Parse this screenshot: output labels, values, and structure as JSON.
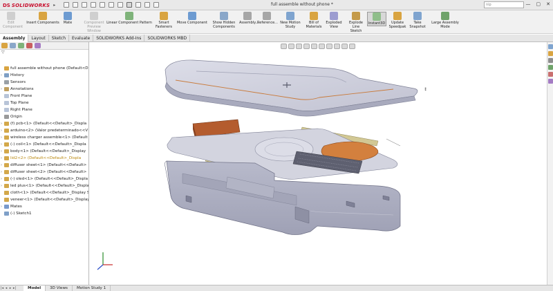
{
  "app": {
    "logo_ds": "DS",
    "logo_word": "SOLIDWORKS",
    "doc_title": "full assemble without phone *",
    "help_search": "nip"
  },
  "titlebar": {
    "window_controls": [
      "—",
      "▢",
      "✕"
    ]
  },
  "ribbon": {
    "buttons": [
      {
        "label": "Edit Component",
        "icon": "edit-component-icon",
        "disabled": true
      },
      {
        "label": "Insert Components",
        "icon": "insert-components-icon"
      },
      {
        "label": "Mate",
        "icon": "mate-icon"
      },
      {
        "label": "Component Preview Window",
        "icon": "preview-window-icon",
        "disabled": true
      },
      {
        "label": "Linear Component Pattern",
        "icon": "linear-pattern-icon"
      },
      {
        "label": "Smart Fasteners",
        "icon": "smart-fasteners-icon"
      },
      {
        "label": "Move Component",
        "icon": "move-component-icon"
      },
      {
        "label": "Show Hidden Components",
        "icon": "show-hidden-icon"
      },
      {
        "label": "Assembly...",
        "icon": "assembly-features-icon"
      },
      {
        "label": "Reference...",
        "icon": "reference-geometry-icon"
      },
      {
        "label": "New Motion Study",
        "icon": "motion-study-icon"
      },
      {
        "label": "Bill of Materials",
        "icon": "bom-icon"
      },
      {
        "label": "Exploded View",
        "icon": "exploded-view-icon"
      },
      {
        "label": "Explode Line Sketch",
        "icon": "explode-line-icon"
      },
      {
        "label": "Instant3D",
        "icon": "instant3d-icon",
        "active": true
      },
      {
        "label": "Update Speedpak",
        "icon": "speedpak-icon"
      },
      {
        "label": "Take Snapshot",
        "icon": "snapshot-icon"
      },
      {
        "label": "Large Assembly Mode",
        "icon": "large-assembly-icon"
      }
    ]
  },
  "command_tabs": [
    "Assembly",
    "Layout",
    "Sketch",
    "Evaluate",
    "SOLIDWORKS Add-Ins",
    "SOLIDWORKS MBD"
  ],
  "filter_icon": "▽",
  "tree": [
    {
      "label": "full assemble without phone  (Default<Displ",
      "icon": "assembly-icon",
      "exp": ""
    },
    {
      "label": "History",
      "icon": "history-icon",
      "exp": "›"
    },
    {
      "label": "Sensors",
      "icon": "sensors-icon",
      "exp": ""
    },
    {
      "label": "Annotations",
      "icon": "annotations-icon",
      "exp": "›"
    },
    {
      "label": "Front Plane",
      "icon": "plane-icon",
      "exp": ""
    },
    {
      "label": "Top Plane",
      "icon": "plane-icon",
      "exp": ""
    },
    {
      "label": "Right Plane",
      "icon": "plane-icon",
      "exp": ""
    },
    {
      "label": "Origin",
      "icon": "origin-icon",
      "exp": ""
    },
    {
      "label": "(f) pcb<1> (Default<<Default>_Displa",
      "icon": "part-icon",
      "exp": "›"
    },
    {
      "label": "arduino<2> (Valor predeterminado<<V",
      "icon": "part-icon",
      "exp": "›"
    },
    {
      "label": "wireless charger assemble<1> (Default",
      "icon": "part-icon",
      "exp": "›"
    },
    {
      "label": "(-) coil<1> (Default<<Default>_Displa",
      "icon": "part-icon",
      "exp": "›"
    },
    {
      "label": "body<1> (Default<<Default>_Display",
      "icon": "part-icon",
      "exp": "›"
    },
    {
      "label": "lid2<2> (Default<<Default>_Displa",
      "icon": "part-icon",
      "exp": "›",
      "warn": true
    },
    {
      "label": "diffuser sheet<1> (Default<<Default>",
      "icon": "part-icon",
      "exp": "›"
    },
    {
      "label": "diffuser sheet<2> (Default<<Default>",
      "icon": "part-icon",
      "exp": "›"
    },
    {
      "label": "(-) oled<1> (Default<<Default>_Displa",
      "icon": "part-icon",
      "exp": "›"
    },
    {
      "label": "led plus<1> (Default<<Default>_Displa",
      "icon": "part-icon",
      "exp": "›"
    },
    {
      "label": "cloth<1> (Default<<Default>_Display S",
      "icon": "part-icon",
      "exp": ""
    },
    {
      "label": "veneer<1> (Default<<Default>_Display",
      "icon": "part-icon",
      "exp": ""
    },
    {
      "label": "Mates",
      "icon": "mates-icon",
      "exp": "›"
    },
    {
      "label": "(-) Sketch1",
      "icon": "sketch-icon",
      "exp": ""
    }
  ],
  "bottom_tabs": [
    "Model",
    "3D Views",
    "Motion Study 1"
  ],
  "colors": {
    "body": "#c4c6d6",
    "body_dark": "#8e90a4",
    "lid": "#d2d3df",
    "copper": "#c8793a",
    "brown_block": "#a9562c",
    "strip": "#c9c08e",
    "pcb": "#6a6a7a"
  }
}
